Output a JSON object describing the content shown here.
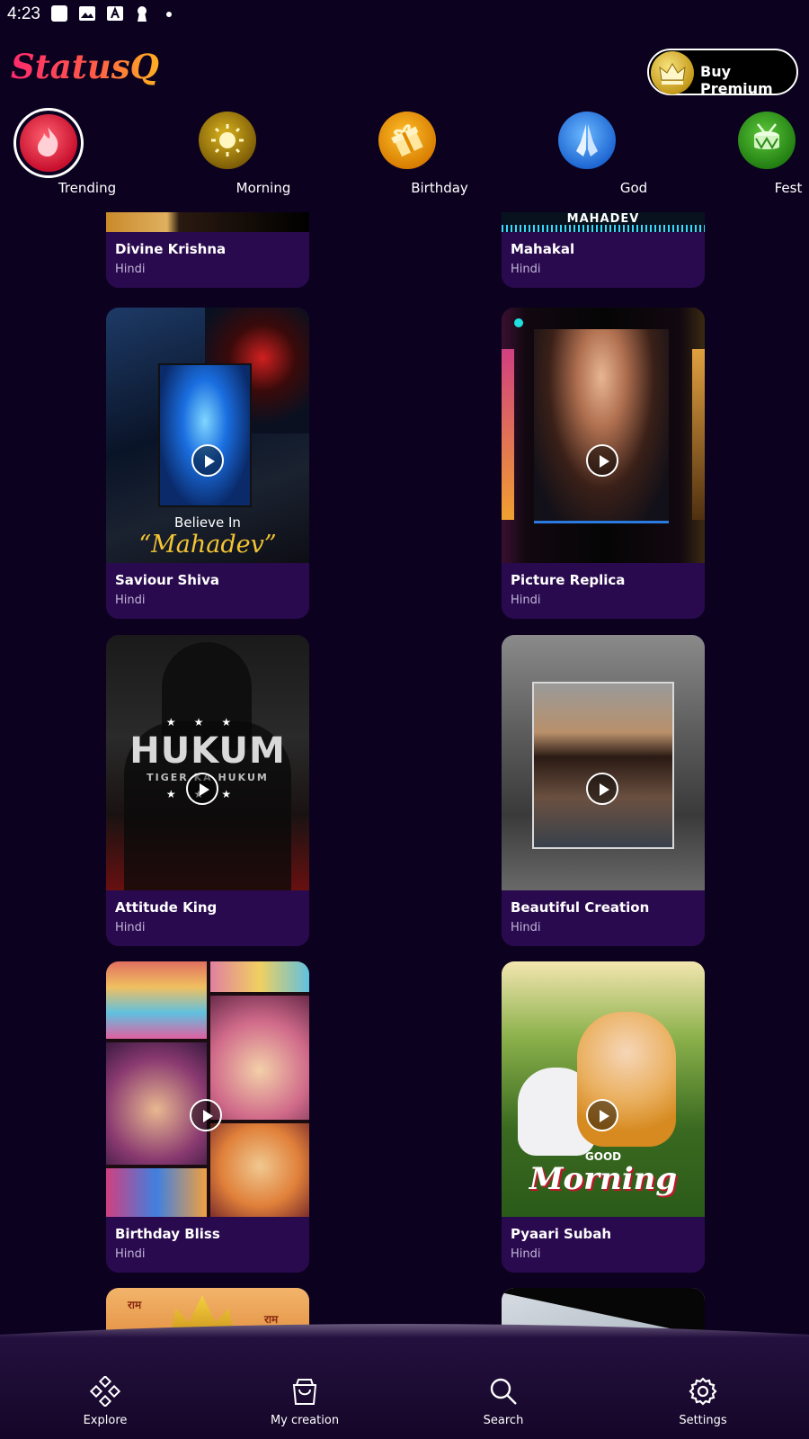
{
  "status_bar": {
    "time": "4:23"
  },
  "header": {
    "logo": "StatusQ",
    "premium_label": "Buy Premium"
  },
  "categories": [
    {
      "label": "Trending",
      "icon": "fire-icon"
    },
    {
      "label": "Morning",
      "icon": "sun-icon"
    },
    {
      "label": "Birthday",
      "icon": "gift-icon"
    },
    {
      "label": "God",
      "icon": "praying-hands-icon"
    },
    {
      "label": "Fest",
      "icon": "drum-icon"
    }
  ],
  "cards": [
    {
      "name": "Divine Krishna",
      "lang": "Hindi"
    },
    {
      "name": "Mahakal",
      "lang": "Hindi",
      "thumb_text": "MAHADEV"
    },
    {
      "name": "Saviour Shiva",
      "lang": "Hindi",
      "thumb_line1": "Believe In",
      "thumb_line2": "“Mahadev”"
    },
    {
      "name": "Picture Replica",
      "lang": "Hindi"
    },
    {
      "name": "Attitude King",
      "lang": "Hindi",
      "thumb_title": "HUKUM",
      "thumb_sub": "TIGER KA HUKUM"
    },
    {
      "name": "Beautiful Creation",
      "lang": "Hindi"
    },
    {
      "name": "Birthday Bliss",
      "lang": "Hindi"
    },
    {
      "name": "Pyaari Subah",
      "lang": "Hindi",
      "thumb_line1": "GOOD",
      "thumb_line2": "Morning"
    },
    {
      "thumb_text": "राम"
    },
    {}
  ],
  "bottom_nav": [
    {
      "label": "Explore",
      "icon": "explore-icon"
    },
    {
      "label": "My creation",
      "icon": "shopping-bag-icon"
    },
    {
      "label": "Search",
      "icon": "search-icon"
    },
    {
      "label": "Settings",
      "icon": "gear-icon"
    }
  ],
  "colors": {
    "background": "#0c0220",
    "card": "#2a0a4e",
    "accent": "#ff2a6d"
  }
}
